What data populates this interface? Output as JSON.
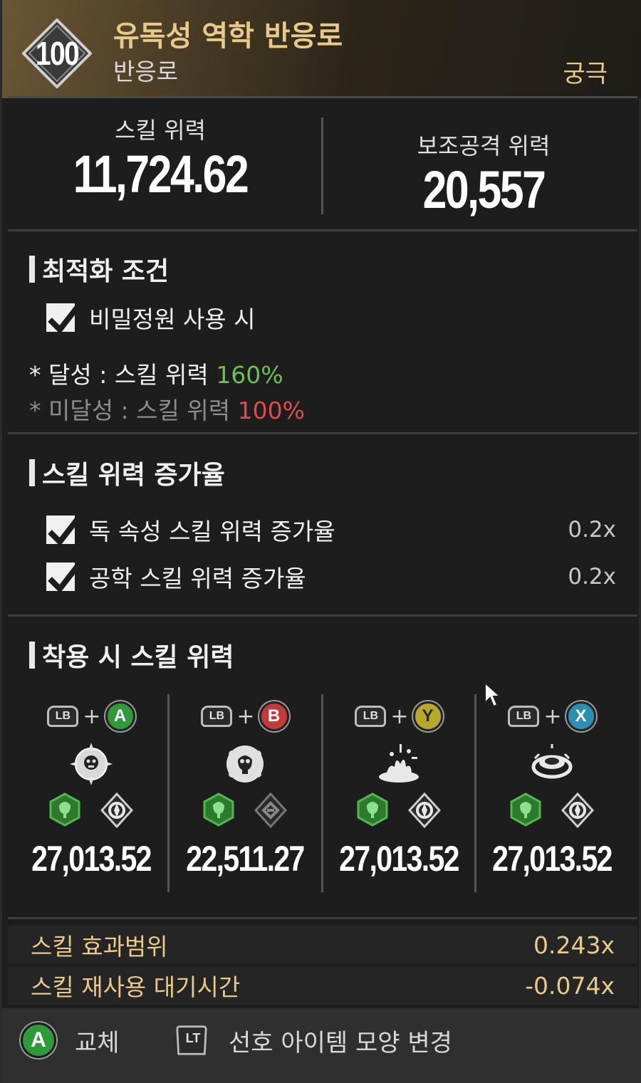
{
  "header": {
    "level": "100",
    "item_name": "유독성 역학 반응로",
    "item_type": "반응로",
    "rarity": "궁극"
  },
  "stats": {
    "skill_power_label": "스킬 위력",
    "skill_power_value": "11,724.62",
    "sub_attack_label": "보조공격 위력",
    "sub_attack_value": "20,557"
  },
  "optimization": {
    "title": "최적화 조건",
    "condition_label": "비밀정원 사용 시",
    "achieved_prefix": "* 달성 : 스킬 위력 ",
    "achieved_value": "160%",
    "failed_prefix": "* 미달성 : 스킬 위력 ",
    "failed_value": "100%"
  },
  "skill_increase": {
    "title": "스킬 위력 증가율",
    "rows": [
      {
        "label": "독 속성 스킬 위력 증가율",
        "value": "0.2x"
      },
      {
        "label": "공학 스킬 위력 증가율",
        "value": "0.2x"
      }
    ]
  },
  "equipped": {
    "title": "착용 시 스킬 위력",
    "combos": [
      {
        "modifier": "LB",
        "plus": "+",
        "button": "A",
        "button_color": "#2e9a3a",
        "value": "27,013.52",
        "skill_icon": "dimension-skill-icon",
        "attribute_icon": "toxic-attribute-icon",
        "type_icon": "tech-type-icon"
      },
      {
        "modifier": "LB",
        "plus": "+",
        "button": "B",
        "button_color": "#c43a3a",
        "value": "22,511.27",
        "skill_icon": "toxic-skull-skill-icon",
        "attribute_icon": "toxic-attribute-icon",
        "type_icon": "dimension-type-icon"
      },
      {
        "modifier": "LB",
        "plus": "+",
        "button": "Y",
        "button_color": "#b9a82a",
        "value": "27,013.52",
        "skill_icon": "splash-skill-icon",
        "attribute_icon": "toxic-attribute-icon",
        "type_icon": "tech-type-icon"
      },
      {
        "modifier": "LB",
        "plus": "+",
        "button": "X",
        "button_color": "#2a8fb0",
        "value": "27,013.52",
        "skill_icon": "ring-skill-icon",
        "attribute_icon": "toxic-attribute-icon",
        "type_icon": "tech-type-icon"
      }
    ]
  },
  "bottom_stats": [
    {
      "label": "스킬 효과범위",
      "value": "0.243x"
    },
    {
      "label": "스킬 재사용 대기시간",
      "value": "-0.074x"
    }
  ],
  "footer": {
    "a_button": "A",
    "swap_label": "교체",
    "lt_button": "LT",
    "appearance_label": "선호 아이템 모양 변경"
  }
}
